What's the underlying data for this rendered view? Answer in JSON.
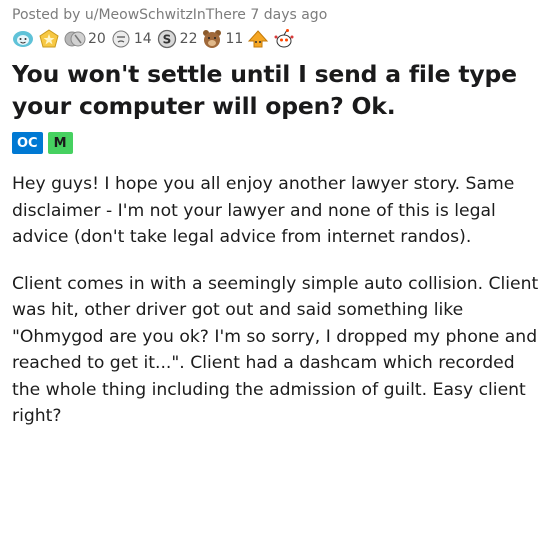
{
  "post": {
    "posted_by_prefix": "Posted by",
    "username": "u/MeowSchwitzInThere",
    "age": "7 days ago",
    "awards": [
      {
        "icon": "wholesome-seal-icon",
        "count": ""
      },
      {
        "icon": "star-badge-icon",
        "count": ""
      },
      {
        "icon": "silver-pair-icon",
        "count": "20"
      },
      {
        "icon": "facepalm-icon",
        "count": "14"
      },
      {
        "icon": "dollar-coin-icon",
        "count": "22"
      },
      {
        "icon": "bear-icon",
        "count": "11"
      },
      {
        "icon": "upvote-hat-icon",
        "count": ""
      },
      {
        "icon": "alien-party-icon",
        "count": ""
      }
    ],
    "title": "You won't settle until I send a file type your computer will open? Ok.",
    "flairs": [
      {
        "label": "OC",
        "color": "#0079d3"
      },
      {
        "label": "M",
        "color": "#46d160"
      }
    ],
    "paragraphs": [
      "Hey guys! I hope you all enjoy another lawyer story. Same disclaimer - I'm not your lawyer and none of this is legal advice (don't take legal advice from internet randos).",
      "Client comes in with a seemingly simple auto collision. Client was hit, other driver got out and said something like \"Ohmygod are you ok? I'm so sorry, I dropped my phone and reached to get it...\". Client had a dashcam which recorded the whole thing including the admission of guilt. Easy client right?"
    ]
  }
}
